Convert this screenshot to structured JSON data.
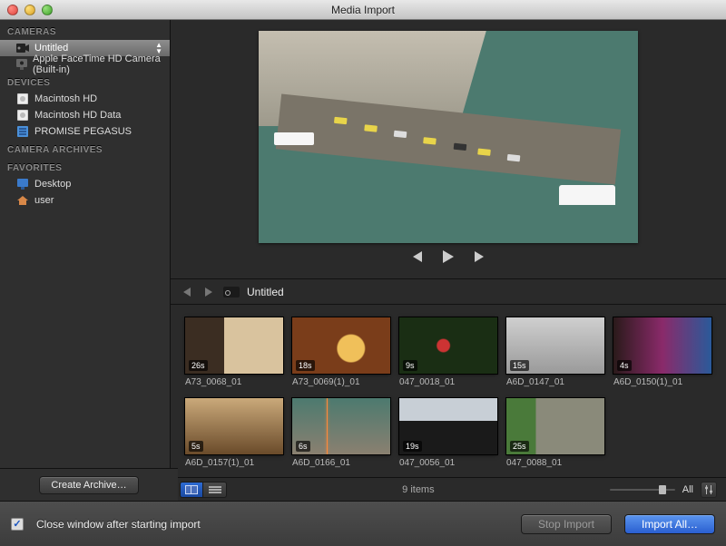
{
  "window": {
    "title": "Media Import"
  },
  "sidebar": {
    "sections": [
      {
        "title": "CAMERAS",
        "items": [
          {
            "label": "Untitled",
            "icon": "camcorder-icon",
            "selected": true,
            "expand": true
          },
          {
            "label": "Apple FaceTime HD Camera (Built-in)",
            "icon": "webcam-icon"
          }
        ]
      },
      {
        "title": "DEVICES",
        "items": [
          {
            "label": "Macintosh HD",
            "icon": "hdd-icon"
          },
          {
            "label": "Macintosh HD Data",
            "icon": "hdd-icon"
          },
          {
            "label": "PROMISE PEGASUS",
            "icon": "raid-icon"
          }
        ]
      },
      {
        "title": "CAMERA ARCHIVES",
        "items": []
      },
      {
        "title": "FAVORITES",
        "items": [
          {
            "label": "Desktop",
            "icon": "desktop-icon"
          },
          {
            "label": "user",
            "icon": "home-icon"
          }
        ]
      }
    ],
    "create_archive": "Create Archive…"
  },
  "browser": {
    "breadcrumb": "Untitled",
    "clips": [
      {
        "name": "A73_0068_01",
        "duration": "26s",
        "thumb": "people"
      },
      {
        "name": "A73_0069(1)_01",
        "duration": "18s",
        "thumb": "food"
      },
      {
        "name": "047_0018_01",
        "duration": "9s",
        "thumb": "flowers"
      },
      {
        "name": "A6D_0147_01",
        "duration": "15s",
        "thumb": "cathedral"
      },
      {
        "name": "A6D_0150(1)_01",
        "duration": "4s",
        "thumb": "stained"
      },
      {
        "name": "A6D_0157(1)_01",
        "duration": "5s",
        "thumb": "hands"
      },
      {
        "name": "A6D_0166_01",
        "duration": "6s",
        "thumb": "bridge",
        "playhead": 35
      },
      {
        "name": "047_0056_01",
        "duration": "19s",
        "thumb": "train"
      },
      {
        "name": "047_0088_01",
        "duration": "25s",
        "thumb": "rail"
      }
    ],
    "count": "9 items",
    "all_label": "All"
  },
  "footer": {
    "close_label": "Close window after starting import",
    "close_checked": true,
    "stop": "Stop Import",
    "import_all": "Import All…"
  }
}
